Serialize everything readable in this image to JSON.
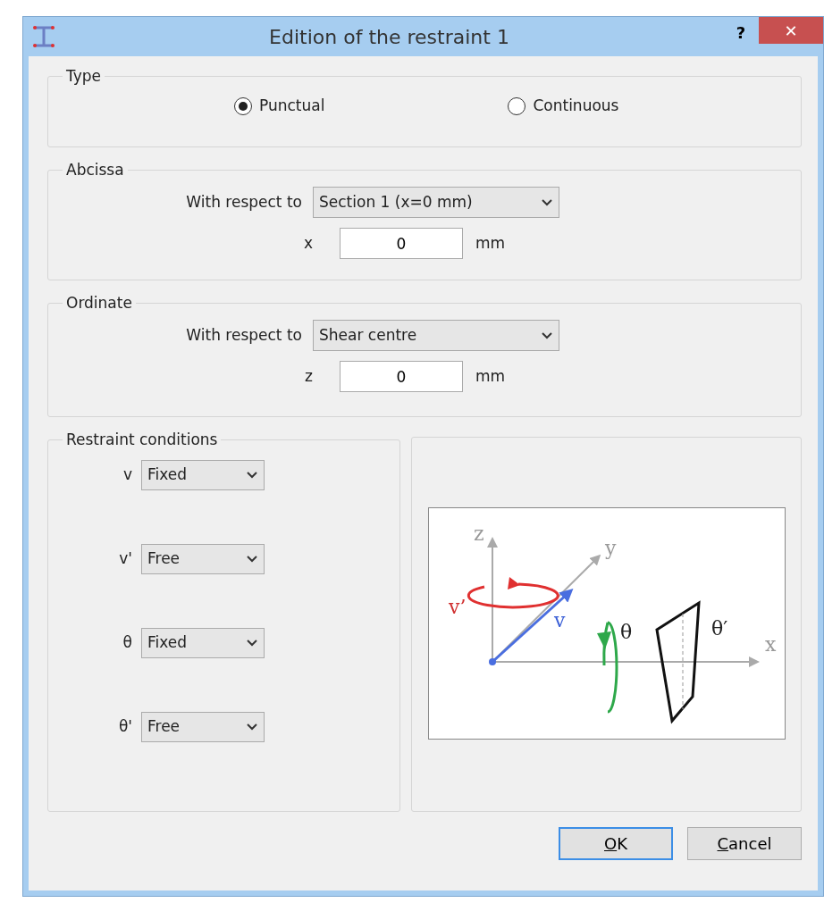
{
  "window": {
    "title": "Edition of the restraint 1",
    "help": "?",
    "close": "✕"
  },
  "type_group": {
    "legend": "Type",
    "options": [
      {
        "label": "Punctual",
        "selected": true
      },
      {
        "label": "Continuous",
        "selected": false
      }
    ]
  },
  "abcissa": {
    "legend": "Abcissa",
    "reference_label": "With respect to",
    "reference_value": "Section 1 (x=0 mm)",
    "field_label": "x",
    "value": "0",
    "unit": "mm"
  },
  "ordinate": {
    "legend": "Ordinate",
    "reference_label": "With respect to",
    "reference_value": "Shear centre",
    "field_label": "z",
    "value": "0",
    "unit": "mm"
  },
  "restraint_conditions": {
    "legend": "Restraint conditions",
    "rows": [
      {
        "label": "v",
        "value": "Fixed"
      },
      {
        "label": "v'",
        "value": "Free"
      },
      {
        "label": "θ",
        "value": "Fixed"
      },
      {
        "label": "θ'",
        "value": "Free"
      }
    ]
  },
  "diagram": {
    "labels": [
      {
        "text": "z",
        "kind": "axis"
      },
      {
        "text": "y",
        "kind": "axis"
      },
      {
        "text": "x",
        "kind": "axis"
      },
      {
        "text": "v’",
        "kind": "dof"
      },
      {
        "text": "v",
        "kind": "dof"
      },
      {
        "text": "θ",
        "kind": "dof"
      },
      {
        "text": "θ′",
        "kind": "dof"
      }
    ]
  },
  "buttons": [
    {
      "label": "OK",
      "default": true,
      "mnemonic_first": true
    },
    {
      "label": "Cancel",
      "default": false,
      "mnemonic_first": true
    }
  ]
}
